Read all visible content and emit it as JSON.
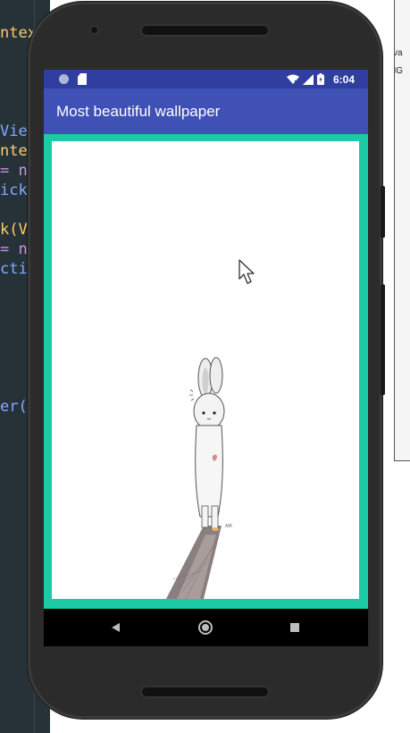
{
  "ide": {
    "code_lines": [
      {
        "text": "ntex",
        "color": "#ffcb6b"
      },
      {
        "text": "View",
        "color": "#82aaff"
      },
      {
        "text": "nter",
        "color": "#ffcb6b"
      },
      {
        "text": "= ne",
        "color": "#c792ea"
      },
      {
        "text": "ick",
        "color": "#82aaff"
      },
      {
        "text": "k(Vi",
        "color": "#ffcb6b"
      },
      {
        "text": "= ne",
        "color": "#c792ea"
      },
      {
        "text": "ctiv",
        "color": "#82aaff"
      },
      {
        "text": "er(V",
        "color": "#82aaff"
      }
    ]
  },
  "right_panel": {
    "fragments": [
      "va",
      "NG"
    ]
  },
  "status_bar": {
    "time": "6:04",
    "icons": [
      "notification-dot-icon",
      "sd-card-icon",
      "wifi-icon",
      "signal-icon",
      "battery-icon"
    ]
  },
  "app_bar": {
    "title": "Most beautiful wallpaper"
  },
  "wallpaper": {
    "description_icon": "bunny-illustration-icon"
  },
  "nav_bar": {
    "buttons": [
      "back-icon",
      "home-icon",
      "recent-apps-icon"
    ]
  },
  "colors": {
    "status_bar": "#303f9f",
    "app_bar": "#3f51b5",
    "frame_accent": "#1ccba5",
    "ide_background": "#263238"
  }
}
